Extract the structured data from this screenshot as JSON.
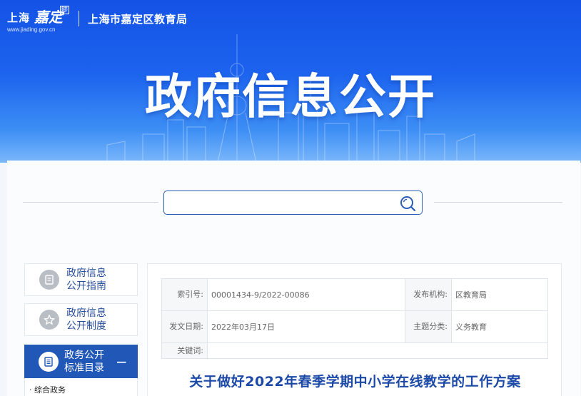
{
  "header": {
    "logo_text": "上海",
    "logo_script": "嘉定",
    "logo_seal": "疁",
    "logo_url": "www.jiading.gov.cn",
    "bureau": "上海市嘉定区教育局",
    "banner_title": "政府信息公开"
  },
  "search": {
    "placeholder": "",
    "icon": "search-icon"
  },
  "sidebar": {
    "items": [
      {
        "label": "政府信息公开指南",
        "icon": "guide-icon"
      },
      {
        "label": "政府信息公开制度",
        "icon": "rules-icon"
      },
      {
        "label": "政务公开标准目录",
        "icon": "catalog-icon",
        "active": true,
        "toggle": "−"
      }
    ],
    "sub_items": [
      {
        "label": "· 综合政务"
      }
    ]
  },
  "meta": {
    "index_label": "索引号:",
    "index_value": "00001434-9/2022-00086",
    "publisher_label": "发布机构:",
    "publisher_value": "区教育局",
    "date_label": "发文日期:",
    "date_value": "2022年03月17日",
    "category_label": "主题分类:",
    "category_value": "义务教育",
    "keywords_label": "关键词:",
    "keywords_value": ""
  },
  "document": {
    "title": "关于做好2022年春季学期中小学在线教学的工作方案"
  },
  "colors": {
    "brand_blue": "#1c63ee",
    "nav_active": "#2158b8",
    "title_blue": "#1d4aa7"
  }
}
